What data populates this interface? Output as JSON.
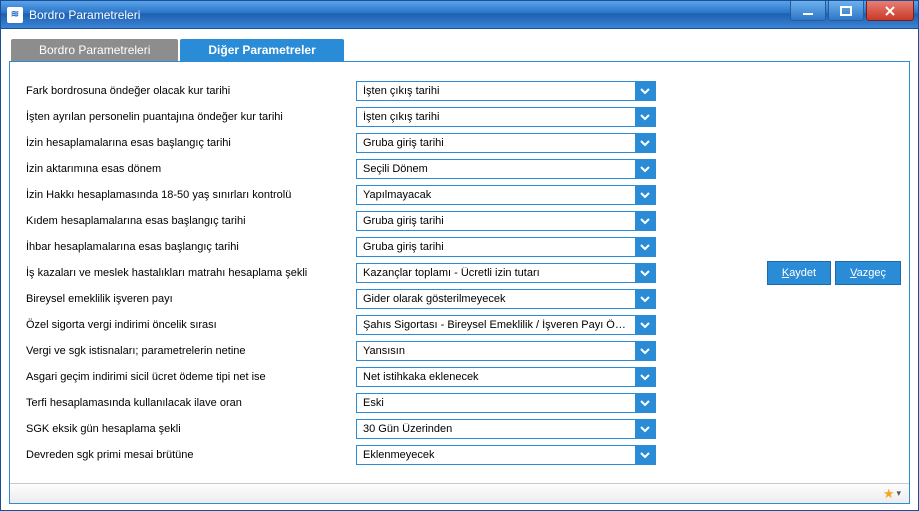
{
  "window": {
    "title": "Bordro Parametreleri"
  },
  "tabs": {
    "inactive": "Bordro Parametreleri",
    "active": "Diğer Parametreler"
  },
  "actions": {
    "save": "Kaydet",
    "save_ul": "K",
    "cancel": "Vazgeç",
    "cancel_ul": "V"
  },
  "rows": [
    {
      "label": "Fark bordrosuna öndeğer olacak kur tarihi",
      "value": "İşten çıkış tarihi"
    },
    {
      "label": "İşten ayrılan personelin puantajına öndeğer kur tarihi",
      "value": "İşten çıkış tarihi"
    },
    {
      "label": "İzin hesaplamalarına esas başlangıç tarihi",
      "value": "Gruba giriş tarihi"
    },
    {
      "label": "İzin aktarımına esas dönem",
      "value": "Seçili Dönem"
    },
    {
      "label": "İzin Hakkı hesaplamasında 18-50 yaş sınırları kontrolü",
      "value": "Yapılmayacak"
    },
    {
      "label": "Kıdem hesaplamalarına esas başlangıç tarihi",
      "value": "Gruba giriş tarihi"
    },
    {
      "label": "İhbar hesaplamalarına esas başlangıç tarihi",
      "value": "Gruba giriş tarihi"
    },
    {
      "label": "İş kazaları ve meslek hastalıkları matrahı hesaplama şekli",
      "value": "Kazançlar toplamı - Ücretli izin tutarı"
    },
    {
      "label": "Bireysel emeklilik işveren payı",
      "value": "Gider olarak gösterilmeyecek"
    },
    {
      "label": "Özel sigorta vergi indirimi öncelik sırası",
      "value": "Şahıs Sigortası - Bireysel Emeklilik / İşveren Payı Öncelikli"
    },
    {
      "label": "Vergi ve sgk istisnaları; parametrelerin netine",
      "value": "Yansısın"
    },
    {
      "label": "Asgari geçim indirimi sicil ücret ödeme tipi net ise",
      "value": "Net istihkaka eklenecek"
    },
    {
      "label": "Terfi hesaplamasında kullanılacak ilave oran",
      "value": "Eski"
    },
    {
      "label": "SGK eksik gün hesaplama şekli",
      "value": "30 Gün Üzerinden"
    },
    {
      "label": "Devreden sgk primi mesai brütüne",
      "value": "Eklenmeyecek"
    }
  ]
}
